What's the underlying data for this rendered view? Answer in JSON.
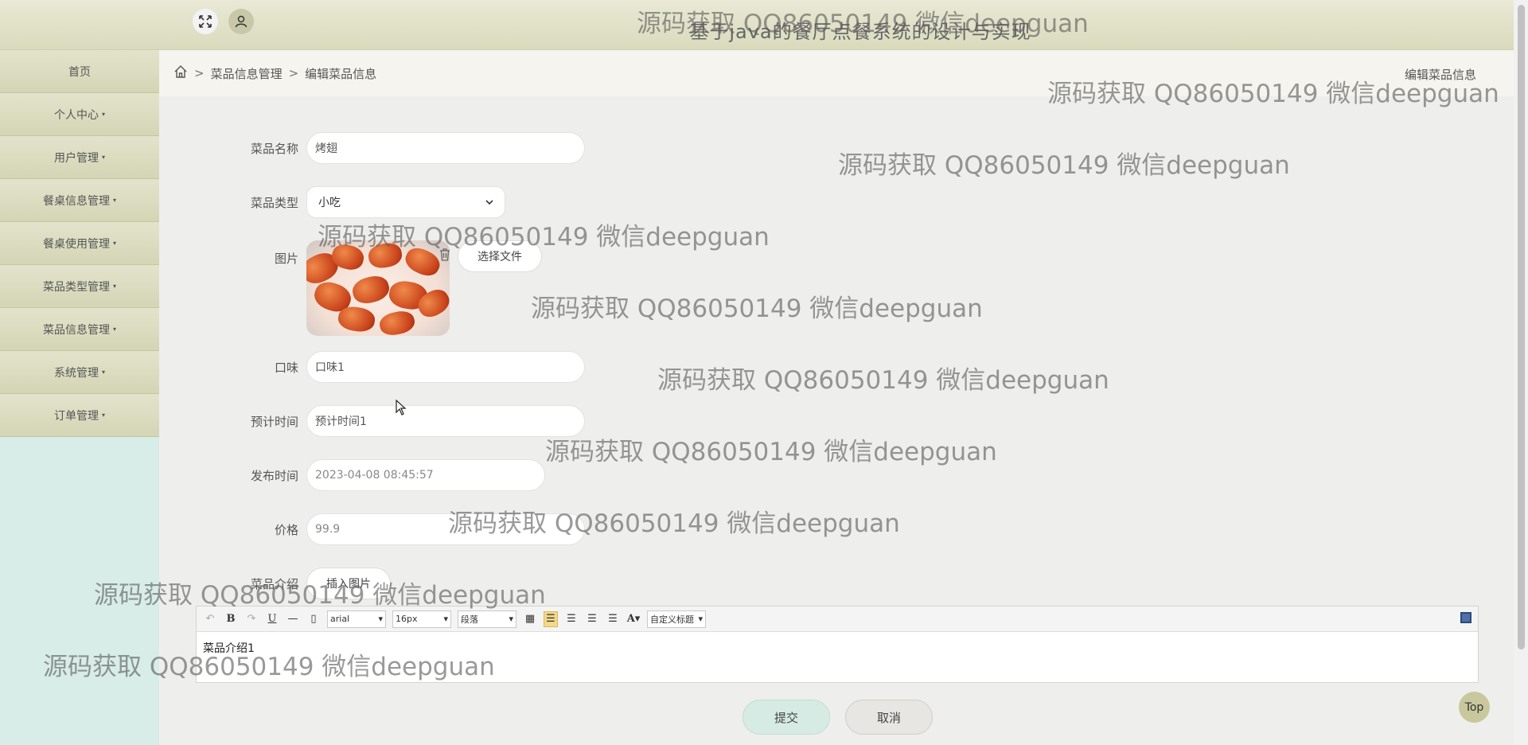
{
  "header": {
    "title": "基于java的餐厅点餐系统的设计与实现",
    "expand_icon": "expand-icon",
    "user_icon": "user-icon"
  },
  "sidebar": {
    "items": [
      {
        "label": "首页",
        "has_caret": false
      },
      {
        "label": "个人中心",
        "has_caret": true
      },
      {
        "label": "用户管理",
        "has_caret": true
      },
      {
        "label": "餐桌信息管理",
        "has_caret": true
      },
      {
        "label": "餐桌使用管理",
        "has_caret": true
      },
      {
        "label": "菜品类型管理",
        "has_caret": true
      },
      {
        "label": "菜品信息管理",
        "has_caret": true
      },
      {
        "label": "系统管理",
        "has_caret": true
      },
      {
        "label": "订单管理",
        "has_caret": true
      }
    ],
    "caret": "▾"
  },
  "breadcrumb": {
    "sep": ">",
    "level1": "菜品信息管理",
    "level2": "编辑菜品信息",
    "right_title": "编辑菜品信息"
  },
  "form": {
    "name": {
      "label": "菜品名称",
      "value": "烤翅"
    },
    "type": {
      "label": "菜品类型",
      "value": "小吃"
    },
    "image": {
      "label": "图片",
      "choose_label": "选择文件"
    },
    "taste": {
      "label": "口味",
      "value": "口味1"
    },
    "time": {
      "label": "预计时间",
      "value": "预计时间1"
    },
    "publish": {
      "label": "发布时间",
      "value": "2023-04-08 08:45:57"
    },
    "price": {
      "label": "价格",
      "value": "99.9"
    },
    "intro": {
      "label": "菜品介绍",
      "insert_image_label": "插入图片"
    }
  },
  "editor": {
    "font": "arial",
    "size": "16px",
    "paragraph": "段落",
    "custom_title": "自定义标题",
    "content": "菜品介绍1"
  },
  "actions": {
    "submit": "提交",
    "cancel": "取消",
    "top": "Top"
  },
  "watermark": "源码获取 QQ86050149 微信deepguan"
}
